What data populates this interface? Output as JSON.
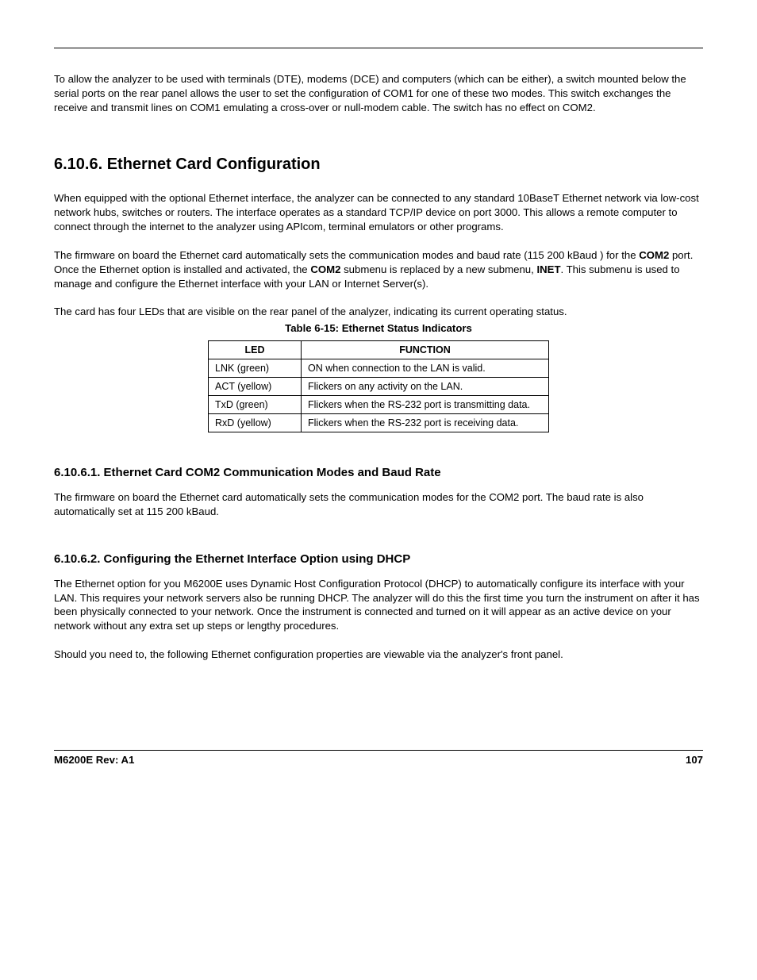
{
  "intro_para": "To allow the analyzer to be used with terminals (DTE), modems (DCE) and computers (which can be either), a switch mounted below the serial ports on the rear panel allows the user to set the configuration of COM1 for one of these two modes.  This switch exchanges the receive and transmit lines on COM1 emulating a cross-over or null-modem cable. The switch has no effect  on COM2.",
  "h2": "6.10.6. Ethernet Card Configuration",
  "p1": "When equipped with the optional Ethernet interface, the analyzer can be connected to any standard 10BaseT Ethernet network via low-cost network hubs, switches or routers. The interface operates as a standard TCP/IP device on port 3000. This allows a remote computer to connect through the internet to the analyzer using APIcom, terminal emulators or other programs.",
  "p2_a": "The firmware on board the Ethernet card automatically sets the communication modes and baud rate (115 200 kBaud ) for the ",
  "p2_b": "COM2",
  "p2_c": " port.  Once the Ethernet option is installed and activated, the ",
  "p2_d": "COM2",
  "p2_e": " submenu is replaced by a new submenu,  ",
  "p2_f": "INET",
  "p2_g": ".  This submenu is used to manage and configure the Ethernet interface with your LAN or Internet Server(s).",
  "p3": "The card has four LEDs that are visible on the rear panel of the analyzer, indicating its current operating status.",
  "table_caption": "Table 6-15:   Ethernet Status Indicators",
  "table": {
    "headers": [
      "LED",
      "FUNCTION"
    ],
    "rows": [
      {
        "led": "LNK (green)",
        "fn": "ON when connection to the LAN is valid."
      },
      {
        "led": "ACT (yellow)",
        "fn": "Flickers on any activity on the LAN."
      },
      {
        "led": "TxD (green)",
        "fn": "Flickers when the RS-232 port is transmitting data."
      },
      {
        "led": "RxD (yellow)",
        "fn": "Flickers when the RS-232 port is receiving data."
      }
    ]
  },
  "h3_1": "6.10.6.1. Ethernet Card COM2 Communication Modes and Baud Rate",
  "p4": "The firmware on board the Ethernet card automatically sets the communication modes for the COM2 port.  The baud rate is also automatically set at 115 200 kBaud.",
  "h3_2": "6.10.6.2. Configuring the Ethernet Interface Option using DHCP",
  "p5": "The Ethernet option for you M6200E uses Dynamic Host Configuration Protocol (DHCP) to automatically configure its interface with your LAN.  This requires your network servers also be running DHCP.  The analyzer will do this the first time you turn the instrument on after it has been physically connected to your network. Once the instrument is connected and turned on it will appear as an active device on your network without any extra set up steps or lengthy procedures.",
  "p6": "Should you need to, the following Ethernet configuration properties are viewable via the analyzer's front panel.",
  "footer_left": "M6200E Rev: A1",
  "footer_right": "107"
}
